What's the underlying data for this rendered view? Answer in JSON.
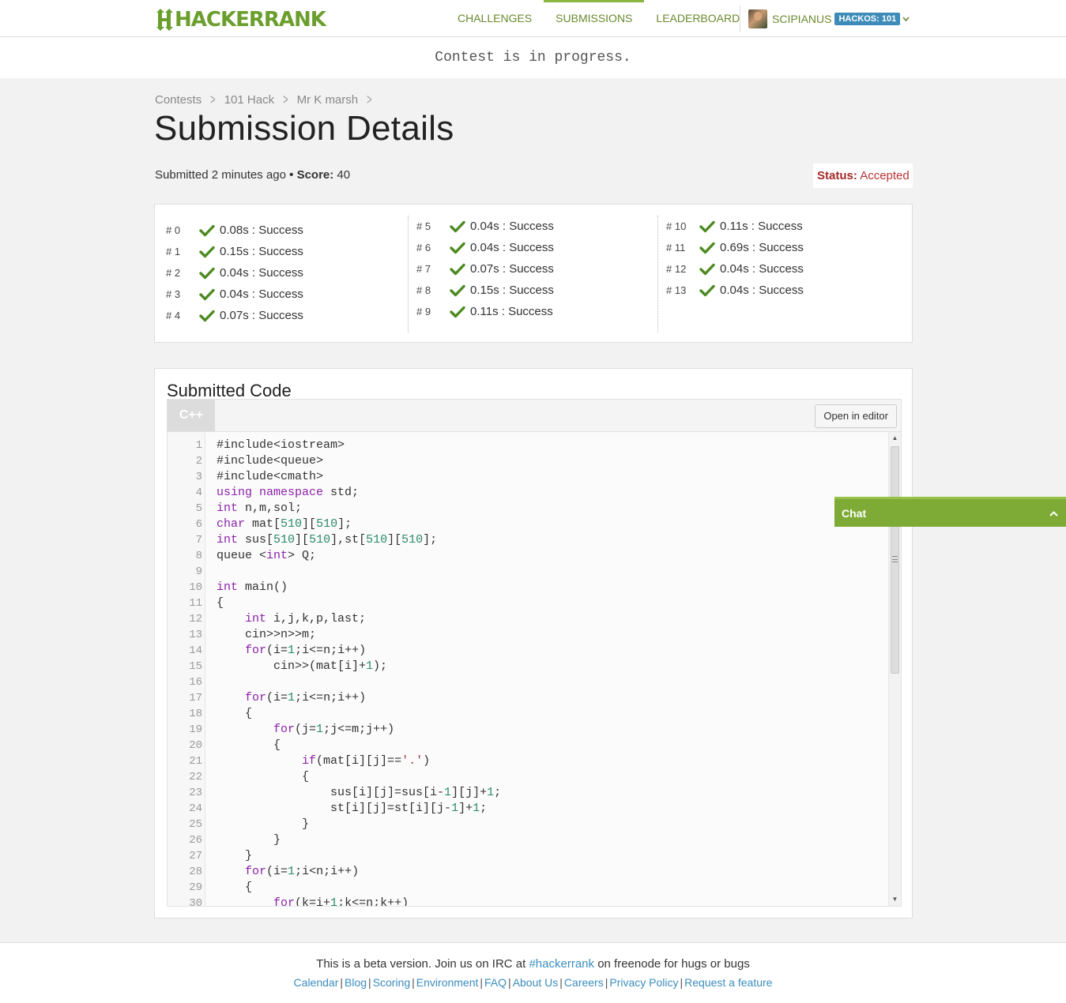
{
  "header": {
    "logo_text": "HACKERRANK",
    "nav": [
      {
        "label": "CHALLENGES",
        "active": false
      },
      {
        "label": "SUBMISSIONS",
        "active": true
      },
      {
        "label": "LEADERBOARD",
        "active": false
      }
    ],
    "user": {
      "name": "SCIPIANUS",
      "hackos": "HACKOS: 101"
    }
  },
  "banner": "Contest is in progress.",
  "breadcrumb": [
    "Contests",
    "101 Hack",
    "Mr K marsh"
  ],
  "page_title": "Submission Details",
  "meta": {
    "submitted_label": "Submitted",
    "submitted_time": "2 minutes ago",
    "separator": "•",
    "score_label": "Score:",
    "score_value": "40"
  },
  "status": {
    "label": "Status:",
    "value": "Accepted"
  },
  "tests": [
    {
      "id": "# 0",
      "result": "0.08s : Success"
    },
    {
      "id": "# 1",
      "result": "0.15s : Success"
    },
    {
      "id": "# 2",
      "result": "0.04s : Success"
    },
    {
      "id": "# 3",
      "result": "0.04s : Success"
    },
    {
      "id": "# 4",
      "result": "0.07s : Success"
    },
    {
      "id": "# 5",
      "result": "0.04s : Success"
    },
    {
      "id": "# 6",
      "result": "0.04s : Success"
    },
    {
      "id": "# 7",
      "result": "0.07s : Success"
    },
    {
      "id": "# 8",
      "result": "0.15s : Success"
    },
    {
      "id": "# 9",
      "result": "0.11s : Success"
    },
    {
      "id": "# 10",
      "result": "0.11s : Success"
    },
    {
      "id": "# 11",
      "result": "0.69s : Success"
    },
    {
      "id": "# 12",
      "result": "0.04s : Success"
    },
    {
      "id": "# 13",
      "result": "0.04s : Success"
    }
  ],
  "code_section": {
    "title": "Submitted Code",
    "language": "C++",
    "open_button": "Open in editor",
    "lines": [
      "#include<iostream>",
      "#include<queue>",
      "#include<cmath>",
      "using namespace std;",
      "int n,m,sol;",
      "char mat[510][510];",
      "int sus[510][510],st[510][510];",
      "queue <int> Q;",
      "",
      "int main()",
      "{",
      "    int i,j,k,p,last;",
      "    cin>>n>>m;",
      "    for(i=1;i<=n;i++)",
      "        cin>>(mat[i]+1);",
      "",
      "    for(i=1;i<=n;i++)",
      "    {",
      "        for(j=1;j<=m;j++)",
      "        {",
      "            if(mat[i][j]=='.')",
      "            {",
      "                sus[i][j]=sus[i-1][j]+1;",
      "                st[i][j]=st[i][j-1]+1;",
      "            }",
      "        }",
      "    }",
      "    for(i=1;i<n;i++)",
      "    {",
      "        for(k=i+1;k<=n;k++)"
    ]
  },
  "chat": {
    "label": "Chat"
  },
  "footer": {
    "note_before": "This is a beta version. Join us on IRC at",
    "note_link": "#hackerrank",
    "note_after": "on freenode for hugs or bugs",
    "links": [
      "Calendar",
      "Blog",
      "Scoring",
      "Environment",
      "FAQ",
      "About Us",
      "Careers",
      "Privacy Policy",
      "Request a feature"
    ]
  },
  "colors": {
    "brand_green": "#6a9e2d",
    "status_red": "#a52a2a",
    "link_blue": "#3b8dbf",
    "hackos_blue": "#3d8bb8"
  }
}
